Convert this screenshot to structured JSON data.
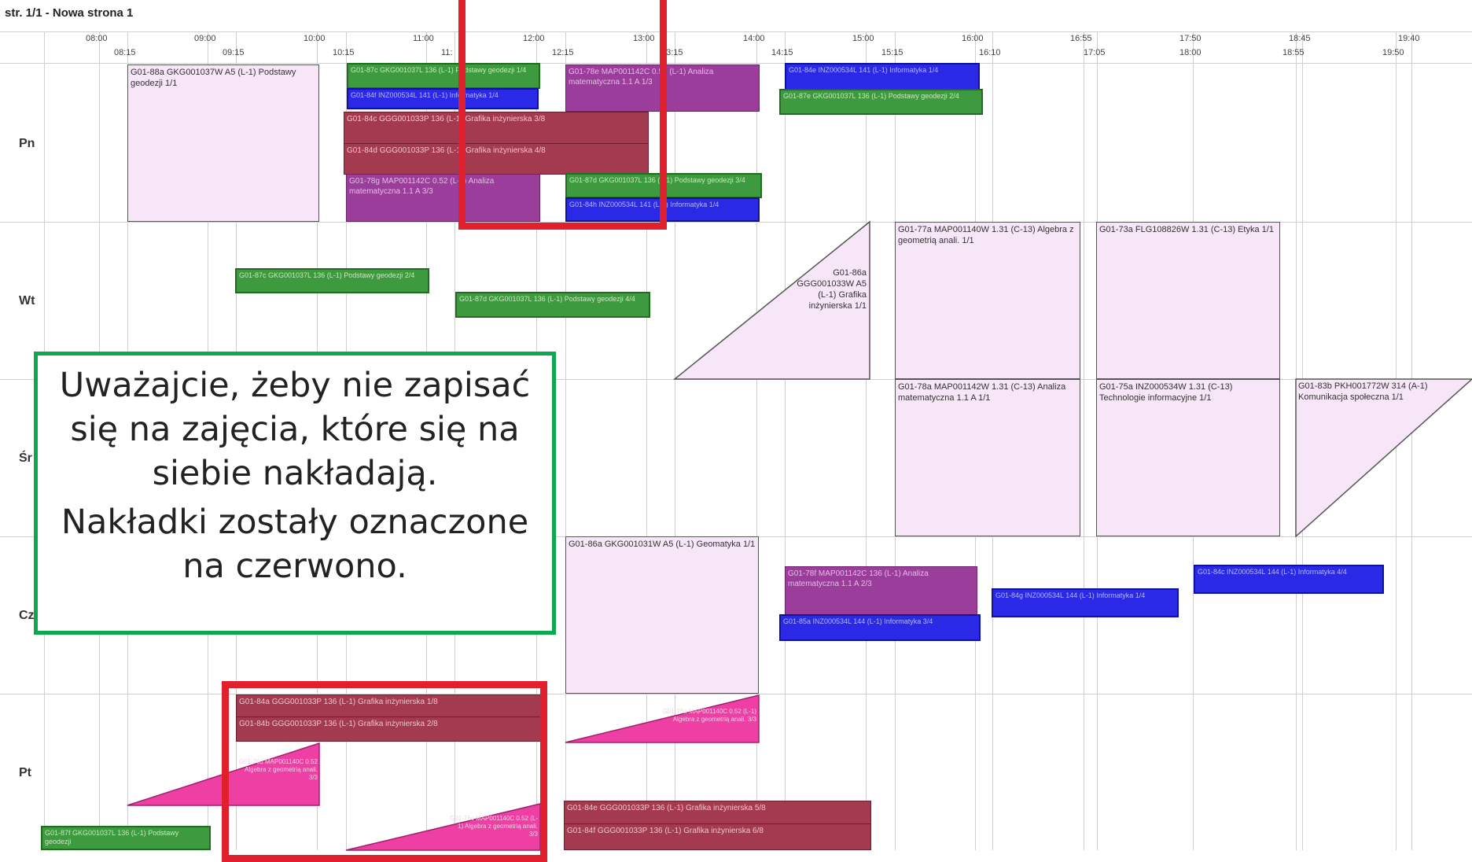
{
  "page_title": "str. 1/1 - Nowa strona 1",
  "time_ticks_top": [
    "08:00",
    "09:00",
    "10:00",
    "11:00",
    "12:00",
    "13:00",
    "14:00",
    "15:00",
    "16:00",
    "16:55",
    "17:50",
    "18:45",
    "19:40"
  ],
  "time_ticks_bottom": [
    "08:15",
    "09:15",
    "10:15",
    "11:",
    "12:15",
    "13:15",
    "14:15",
    "15:15",
    "16:10",
    "17:05",
    "18:00",
    "18:55",
    "19:50"
  ],
  "days": [
    "Pn",
    "Wt",
    "Śr",
    "Cz",
    "Pt"
  ],
  "lectures": {
    "pn_geodezja": "G01-88a GKG001037W A5 (L-1) Podstawy geodezji 1/1",
    "wt_algebra": "G01-77a MAP001140W 1.31 (C-13) Algebra z geometrią anali. 1/1",
    "wt_etyka": "G01-73a FLG108826W 1.31 (C-13) Etyka 1/1",
    "wt_grafika": "G01-86a GGG001033W A5 (L-1) Grafika inżynierska 1/1",
    "sr_analiza": "G01-78a MAP001142W 1.31 (C-13) Analiza matematyczna 1.1 A 1/1",
    "sr_technologie": "G01-75a INZ000534W 1.31 (C-13) Technologie informacyjne 1/1",
    "sr_komunikacja": "G01-83b PKH001772W 314 (A-1) Komunikacja społeczna 1/1",
    "cz_geomatyka": "G01-86a GKG001031W A5 (L-1) Geomatyka 1/1"
  },
  "groups": {
    "pn_green_1": "G01-87c GKG001037L 136 (L-1) Podstawy geodezji 1/4",
    "pn_blue_1": "G01-84f INZ000534L 141 (L-1) Informatyka 1/4",
    "pn_purple_1": "G01-78e MAP001142C 0.52 (L-1) Analiza matematyczna 1.1 A 1/3",
    "pn_maroon_1": "G01-84c GGG001033P 136 (L-1) Grafika inżynierska 3/8",
    "pn_maroon_2": "G01-84d GGG001033P 136 (L-1) Grafika inżynierska 4/8",
    "pn_purple_2": "G01-78g MAP001142C 0.52 (L-1) Analiza matematyczna 1.1 A 3/3",
    "pn_green_2": "G01-87d GKG001037L 136 (L-1) Podstawy geodezji 3/4",
    "pn_blue_2": "G01-84h INZ000534L 141 (L-1) Informatyka 1/4",
    "pn_blue_3": "G01-84e INZ000534L 141 (L-1) Informatyka 1/4",
    "pn_green_3": "G01-87e GKG001037L 136 (L-1) Podstawy geodezji 2/4",
    "wt_green_1": "G01-87c GKG001037L 136 (L-1) Podstawy geodezji 2/4",
    "wt_green_2": "G01-87d GKG001037L 136 (L-1) Podstawy geodezji 4/4",
    "cz_purple": "G01-78f MAP001142C 136 (L-1) Analiza matematyczna 1.1 A 2/3",
    "cz_blue_1": "G01-85a INZ000534L 144 (L-1) Informatyka 3/4",
    "cz_blue_2": "G01-84g INZ000534L 144 (L-1) Informatyka 1/4",
    "cz_blue_3": "G01-84c INZ000534L 144 (L-1) Informatyka 4/4",
    "pt_maroon_1": "G01-84a GGG001033P 136 (L-1) Grafika inżynierska 1/8",
    "pt_maroon_2": "G01-84b GGG001033P 136 (L-1) Grafika inżynierska 2/8",
    "pt_maroon_3": "G01-84e GGG001033P 136 (L-1) Grafika inżynierska 5/8",
    "pt_maroon_4": "G01-84f GGG001033P 136 (L-1) Grafika inżynierska 6/8",
    "pt_green": "G01-87f GKG001037L 136 (L-1) Podstawy geodezji",
    "pt_pink_1": "G01-76d MAP001140C 0.52 Algebra z geometrią anali. 3/3",
    "pt_pink_2": "G01-76a MAP001140C 0.52 (L-1) Algebra z geometrią anali. 3/3",
    "pt_pink_3": "G01-76c MAP001140C 0.52 (L-1) Algebra z geometrią anali. 3/3"
  },
  "note": {
    "line1": "Uważajcie, żeby nie zapisać się na zajęcia, które się na siebie nakładają.",
    "line2": "Nakładki zostały oznaczone na czerwono."
  },
  "colors": {
    "overlap_highlight": "#e0202c",
    "note_border": "#0ea64f",
    "lecture_bg": "#f7e6f7",
    "lab_green": "#3e9a3e",
    "lab_blue": "#2a2ae6",
    "exercise_purple": "#9b3d9b",
    "project_maroon": "#a33a50",
    "exercise_pink": "#ee3fa4"
  }
}
